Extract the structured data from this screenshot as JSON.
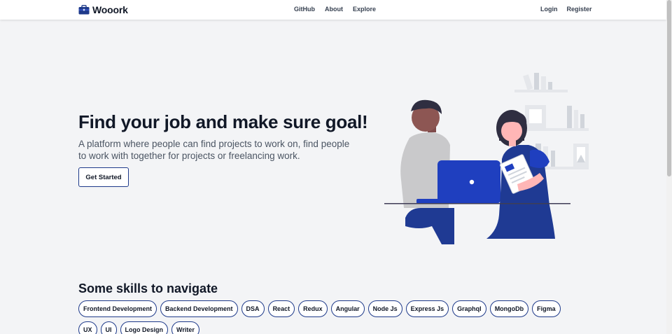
{
  "navbar": {
    "brand": "Wooork",
    "brand_icon": "briefcase-icon",
    "links": [
      "GitHub",
      "About",
      "Explore"
    ],
    "auth": {
      "login": "Login",
      "register": "Register"
    }
  },
  "hero": {
    "title": "Find your job and make sure goal!",
    "subtitle": "A platform where people can find projects to work on, find people to work with together for projects or freelancing work.",
    "cta": "Get Started"
  },
  "skills": {
    "title": "Some skills to navigate",
    "items": [
      "Frontend Development",
      "Backend Development",
      "DSA",
      "React",
      "Redux",
      "Angular",
      "Node Js",
      "Express Js",
      "Graphql",
      "MongoDb",
      "Figma",
      "UX",
      "UI",
      "Logo Design",
      "Writer"
    ]
  },
  "colors": {
    "accent": "#1e3a8a",
    "primary_blue": "#1f3fbf",
    "background": "#f3f4f6",
    "text": "#111827"
  }
}
